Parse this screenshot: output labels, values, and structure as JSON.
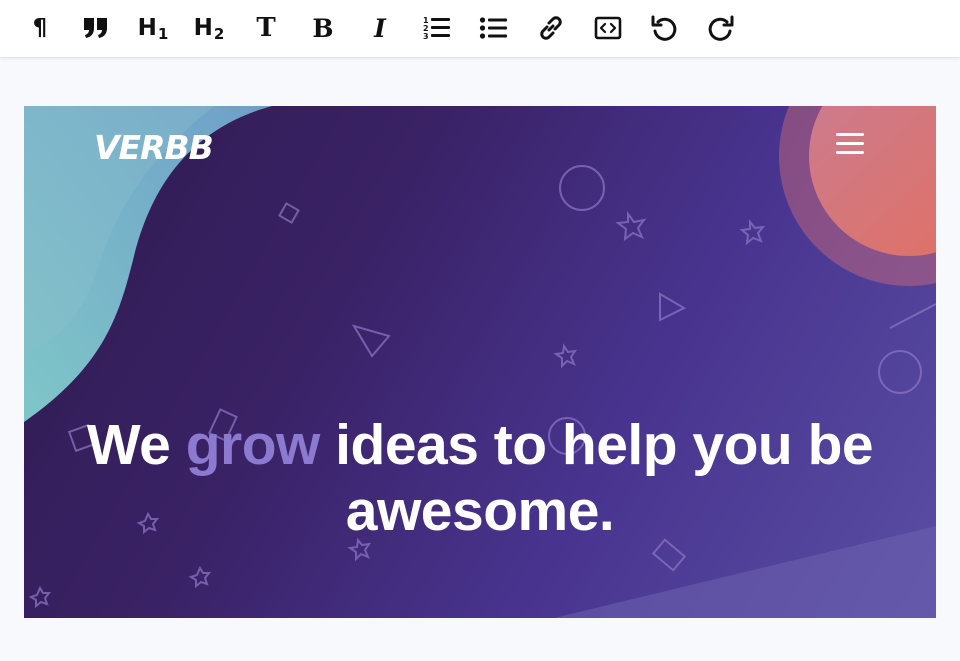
{
  "toolbar": {
    "items": [
      {
        "name": "paragraph-icon",
        "glyph": "¶"
      },
      {
        "name": "blockquote-icon",
        "glyph": "quote"
      },
      {
        "name": "heading-1-icon",
        "big": "H",
        "sub": "1"
      },
      {
        "name": "heading-2-icon",
        "big": "H",
        "sub": "2"
      },
      {
        "name": "text-icon",
        "glyph": "T"
      },
      {
        "name": "bold-icon",
        "glyph": "B"
      },
      {
        "name": "italic-icon",
        "glyph": "I"
      },
      {
        "name": "ordered-list-icon"
      },
      {
        "name": "bullet-list-icon"
      },
      {
        "name": "link-icon"
      },
      {
        "name": "code-block-icon"
      },
      {
        "name": "undo-icon"
      },
      {
        "name": "redo-icon"
      }
    ]
  },
  "hero": {
    "logo": "VERBB",
    "menu_icon": "hamburger-menu-icon",
    "headline_before": "We ",
    "headline_accent": "grow",
    "headline_after": " ideas to help you be awesome."
  },
  "colors": {
    "toolbar_bg": "#ffffff",
    "page_bg": "#f8f9fc",
    "hero_dark": "#2f1b4f",
    "hero_purple": "#48348f",
    "wave_teal": "#7fc6c8",
    "wave_blue": "#6ea8c8",
    "circle_coral": "#d9756e",
    "accent_text": "#8b7ad0"
  }
}
